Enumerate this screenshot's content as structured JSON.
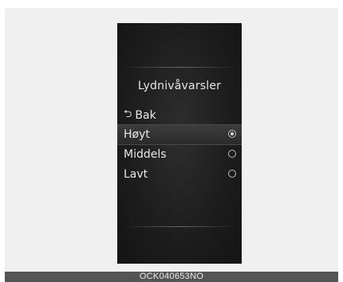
{
  "screen": {
    "title": "Lydnivåvarsler",
    "back_label": "Bak",
    "back_icon": "return-arrow-icon",
    "options": [
      {
        "label": "Høyt",
        "selected": true
      },
      {
        "label": "Middels",
        "selected": false
      },
      {
        "label": "Lavt",
        "selected": false
      }
    ]
  },
  "caption": {
    "code": "OCK040653NO"
  }
}
